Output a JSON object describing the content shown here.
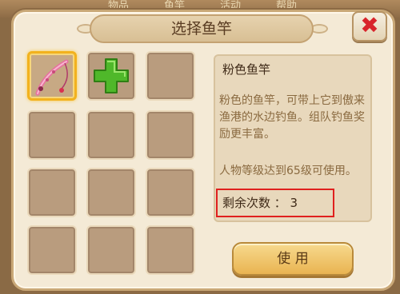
{
  "background_tabs": [
    "物品",
    "鱼竿",
    "活动",
    "帮助"
  ],
  "dialog": {
    "title": "选择鱼竿",
    "close_label": "✖"
  },
  "inventory": {
    "slots": [
      {
        "content": "pink-fishing-rod",
        "selected": true
      },
      {
        "content": "add-plus",
        "selected": false
      },
      {
        "content": "empty",
        "selected": false
      },
      {
        "content": "empty",
        "selected": false
      },
      {
        "content": "empty",
        "selected": false
      },
      {
        "content": "empty",
        "selected": false
      },
      {
        "content": "empty",
        "selected": false
      },
      {
        "content": "empty",
        "selected": false
      },
      {
        "content": "empty",
        "selected": false
      },
      {
        "content": "empty",
        "selected": false
      },
      {
        "content": "empty",
        "selected": false
      },
      {
        "content": "empty",
        "selected": false
      }
    ]
  },
  "item_detail": {
    "name": "粉色鱼竿",
    "description": "粉色的鱼竿，可带上它到傲来渔港的水边钓鱼。组队钓鱼奖励更丰富。",
    "level_requirement": "人物等级达到65级可使用。",
    "remaining_uses": "剩余次数 ： 3"
  },
  "actions": {
    "use_label": "使 用"
  },
  "colors": {
    "highlight_box": "#e0201e",
    "selected_border": "#f2b21e",
    "close_x": "#d8232a",
    "plus_green": "#4fb82a"
  }
}
